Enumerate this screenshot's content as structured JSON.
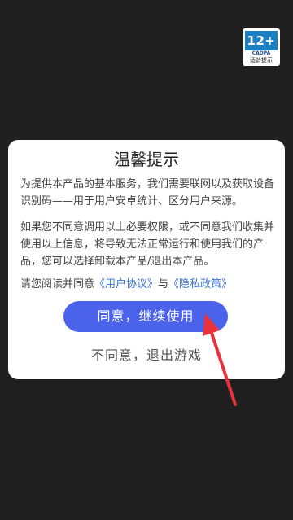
{
  "age_badge": {
    "rating": "12+",
    "org": "CADPA",
    "tip": "适龄提示"
  },
  "dialog": {
    "title": "温馨提示",
    "paragraph1": "为提供本产品的基本服务，我们需要联网以及获取设备识别码——用于用户安卓统计、区分用户来源。",
    "paragraph2": "如果您不同意调用以上必要权限，或不同意我们收集并使用以上信息，将导致无法正常运行和使用我们的产品，您可以选择卸载本产品/退出本产品。",
    "consent_prefix": "请您阅读并同意",
    "user_agreement_link": "《用户协议》",
    "consent_and": "与",
    "privacy_policy_link": "《隐私政策》",
    "agree_button": "同意，继续使用",
    "disagree_button": "不同意，退出游戏"
  },
  "colors": {
    "background": "#1f1f1f",
    "accent": "#4a63ea",
    "link": "#3a73d9",
    "annotation_arrow": "#e8323c"
  }
}
